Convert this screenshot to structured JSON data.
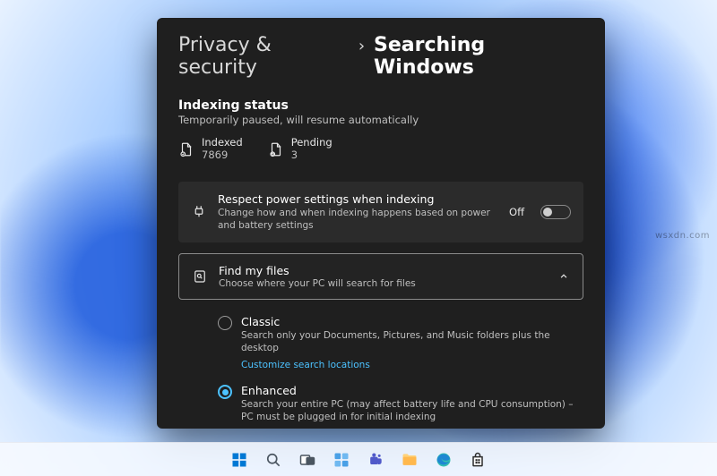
{
  "breadcrumb": {
    "parent": "Privacy & security",
    "current": "Searching Windows"
  },
  "indexing": {
    "title": "Indexing status",
    "subtitle": "Temporarily paused, will resume automatically",
    "stats": {
      "indexed": {
        "label": "Indexed",
        "value": "7869"
      },
      "pending": {
        "label": "Pending",
        "value": "3"
      }
    }
  },
  "power_card": {
    "title": "Respect power settings when indexing",
    "subtitle": "Change how and when indexing happens based on power and battery settings",
    "state": "Off"
  },
  "find_files": {
    "title": "Find my files",
    "subtitle": "Choose where your PC will search for files",
    "options": {
      "classic": {
        "title": "Classic",
        "subtitle": "Search only your Documents, Pictures, and Music folders plus the desktop",
        "link": "Customize search locations",
        "selected": false
      },
      "enhanced": {
        "title": "Enhanced",
        "subtitle": "Search your entire PC (may affect battery life and CPU consumption) – PC must be plugged in for initial indexing",
        "selected": true
      }
    }
  },
  "taskbar": {
    "items": [
      "start",
      "search",
      "taskview",
      "widgets",
      "teams",
      "explorer",
      "edge",
      "store"
    ]
  }
}
